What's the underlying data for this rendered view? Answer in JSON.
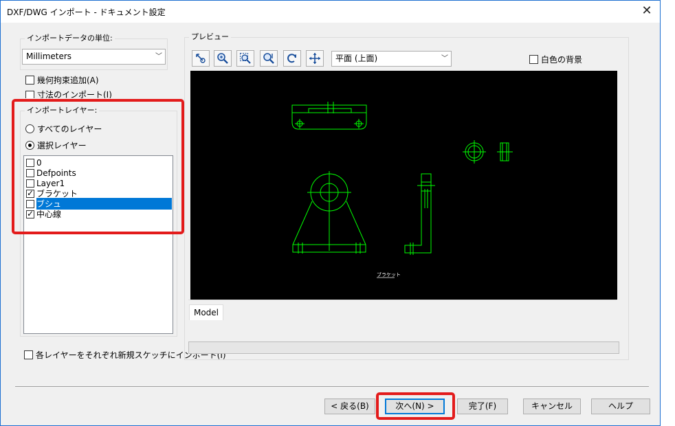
{
  "window": {
    "title": "DXF/DWG インポート - ドキュメント設定"
  },
  "units": {
    "legend": "インポートデータの単位:",
    "value": "Millimeters"
  },
  "options": {
    "add_constraints": {
      "label": "幾何拘束追加(A)",
      "checked": false
    },
    "import_dimensions": {
      "label": "寸法のインポート(I)",
      "checked": false
    }
  },
  "layers": {
    "legend": "インポートレイヤー:",
    "radio_all": {
      "label": "すべてのレイヤー",
      "checked": false
    },
    "radio_selected": {
      "label": "選択レイヤー",
      "checked": true
    },
    "items": [
      {
        "name": "0",
        "checked": false,
        "selected": false
      },
      {
        "name": "Defpoints",
        "checked": false,
        "selected": false
      },
      {
        "name": "Layer1",
        "checked": false,
        "selected": false
      },
      {
        "name": "ブラケット",
        "checked": true,
        "selected": false
      },
      {
        "name": "ブシュ",
        "checked": false,
        "selected": true
      },
      {
        "name": "中心線",
        "checked": true,
        "selected": false
      }
    ]
  },
  "each_layer_sketch": {
    "label": "各レイヤーをそれぞれ新規スケッチにインポート(I)",
    "checked": false
  },
  "preview": {
    "legend": "プレビュー",
    "view_select": "平面 (上面)",
    "white_background": {
      "label": "白色の背景",
      "checked": false
    },
    "toolbar_icons": [
      "zoom-fit-icon",
      "zoom-in-out-icon",
      "zoom-window-icon",
      "zoom-select-icon",
      "redraw-icon",
      "pan-icon"
    ],
    "drawing_label": "ブラケット",
    "tab": "Model",
    "line_color": "#00ff00"
  },
  "buttons": {
    "back": "< 戻る(B)",
    "next": "次へ(N) >",
    "finish": "完了(F)",
    "cancel": "キャンセル",
    "help": "ヘルプ"
  },
  "accent": {
    "highlight": "#e31b1b",
    "selection": "#0078d7"
  }
}
